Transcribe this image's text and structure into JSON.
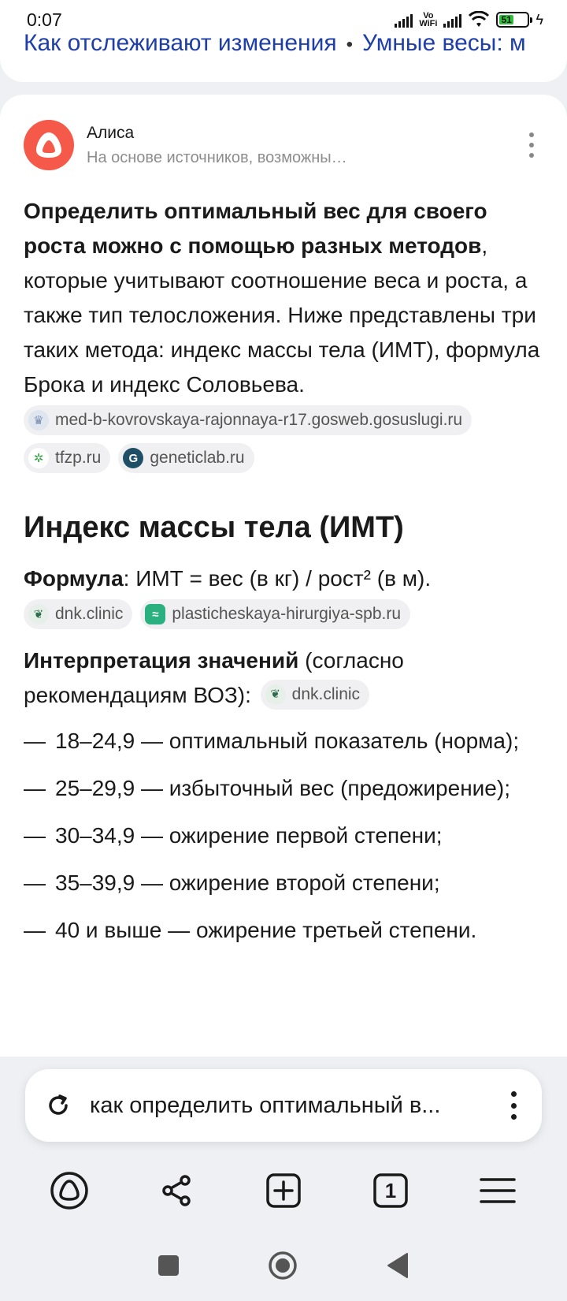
{
  "status_bar": {
    "time": "0:07",
    "network_label": "Vo\nWiFi",
    "battery_level": "51"
  },
  "prev_card": {
    "links": [
      "Как отслеживают изменения",
      "Умные весы: м"
    ]
  },
  "alice": {
    "name": "Алиса",
    "subtitle": "На основе источников, возможны…"
  },
  "answer": {
    "bold_text": "Определить оптимальный вес для своего роста можно с помощью разных методов",
    "rest_text": ", которые учитывают соотношение веса и роста, а также тип телосложения. Ниже представлены три таких метода: индекс массы тела (ИМТ), формула Брока и индекс Соловьева.",
    "sources": [
      {
        "label": "med-b-kovrovskaya-rajonnaya-r17.gosweb.gosuslugi.ru",
        "icon": "gov-emblem-icon"
      },
      {
        "label": "tfzp.ru",
        "icon": "tfzp-icon"
      },
      {
        "label": "geneticlab.ru",
        "icon": "geneticlab-icon"
      }
    ]
  },
  "section": {
    "heading": "Индекс массы тела (ИМТ)",
    "formula_label": "Формула",
    "formula_text": ": ИМТ = вес (в кг) / рост² (в м).",
    "formula_sources": [
      {
        "label": "dnk.clinic",
        "icon": "dnk-clinic-icon"
      },
      {
        "label": "plasticheskaya-hirurgiya-spb.ru",
        "icon": "plastic-surgery-icon"
      }
    ],
    "interp_label": "Интерпретация значений",
    "interp_text": " (согласно рекомендациям ВОЗ):",
    "interp_source": "dnk.clinic",
    "items": [
      "18–24,9 — оптимальный показатель (норма);",
      "25–29,9 — избыточный вес (предожирение);",
      "30–34,9 — ожирение первой степени;",
      "35–39,9 — ожирение второй степени;",
      "40 и выше — ожирение третьей степени."
    ],
    "dash": "—"
  },
  "search": {
    "query": "как определить оптимальный в..."
  },
  "toolbar": {
    "tab_count": "1"
  }
}
